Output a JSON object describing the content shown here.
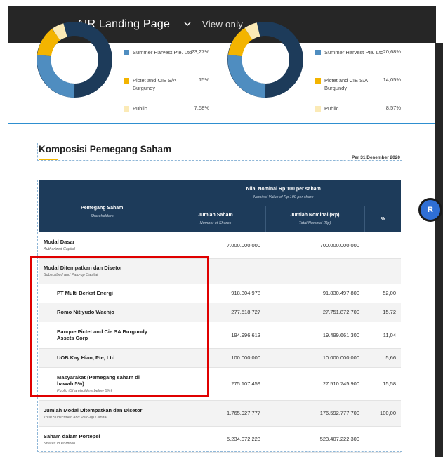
{
  "toolbar": {
    "app_title": "AIR Landing Page",
    "view_only": "View only"
  },
  "charts": [
    {
      "legend": [
        {
          "label": "Summer Harvest Pte. Ltd",
          "pct": "23,27%",
          "color": "#4f8dc0"
        },
        {
          "label": "Pictet and CIE S/A Burgundy",
          "pct": "15%",
          "color": "#f3b400"
        },
        {
          "label": "Public",
          "pct": "7,58%",
          "color": "#fbeab6"
        }
      ]
    },
    {
      "legend": [
        {
          "label": "Summer Harvest Pte. Ltd",
          "pct": "20,68%",
          "color": "#4f8dc0"
        },
        {
          "label": "Pictet and CIE S/A Burgundy",
          "pct": "14,05%",
          "color": "#f3b400"
        },
        {
          "label": "Public",
          "pct": "8,57%",
          "color": "#fbeab6"
        }
      ]
    }
  ],
  "section": {
    "title": "Komposisi Pemegang Saham",
    "per_date": "Per 31 Desember 2020"
  },
  "table": {
    "head": {
      "col1": "Pemegang Saham",
      "col1_sub": "Shareholders",
      "group": "Nilai Nominal Rp 100 per saham",
      "group_sub": "Nominal Value of Rp 100 per share",
      "shares": "Jumlah Saham",
      "shares_sub": "Number of Shares",
      "nominal": "Jumlah Nominal (Rp)",
      "nominal_sub": "Total Nominal (Rp)",
      "pct": "%"
    },
    "rows": [
      {
        "name": "Modal Dasar",
        "sub": "Authorized Capital",
        "shares": "7.000.000.000",
        "nominal": "700.000.000.000",
        "pct": ""
      },
      {
        "name": "Modal Ditempatkan dan Disetor",
        "sub": "Subscribed and Paid-up Capital",
        "shares": "",
        "nominal": "",
        "pct": ""
      },
      {
        "name": "PT Multi Berkat Energi",
        "sub": "",
        "shares": "918.304.978",
        "nominal": "91.830.497.800",
        "pct": "52,00"
      },
      {
        "name": "Romo Nitiyudo Wachjo",
        "sub": "",
        "shares": "277.518.727",
        "nominal": "27.751.872.700",
        "pct": "15,72"
      },
      {
        "name": "Banque Pictet and Cie SA Burgundy Assets Corp",
        "sub": "",
        "shares": "194.996.613",
        "nominal": "19.499.661.300",
        "pct": "11,04"
      },
      {
        "name": "UOB Kay Hian, Pte, Ltd",
        "sub": "",
        "shares": "100.000.000",
        "nominal": "10.000.000.000",
        "pct": "5,66"
      },
      {
        "name": "Masyarakat (Pemegang saham di bawah 5%)",
        "sub": "Public (Shareholders below 5%)",
        "shares": "275.107.459",
        "nominal": "27.510.745.900",
        "pct": "15,58"
      },
      {
        "name": "Jumlah Modal Ditempatkan dan Disetor",
        "sub": "Total Subscribed and Paid-up Capital",
        "shares": "1.765.927.777",
        "nominal": "176.592.777.700",
        "pct": "100,00"
      },
      {
        "name": "Saham dalam Portepel",
        "sub": "Shares in Portfolio",
        "shares": "5.234.072.223",
        "nominal": "523.407.222.300",
        "pct": ""
      }
    ]
  },
  "avatar": {
    "initial": "R"
  }
}
